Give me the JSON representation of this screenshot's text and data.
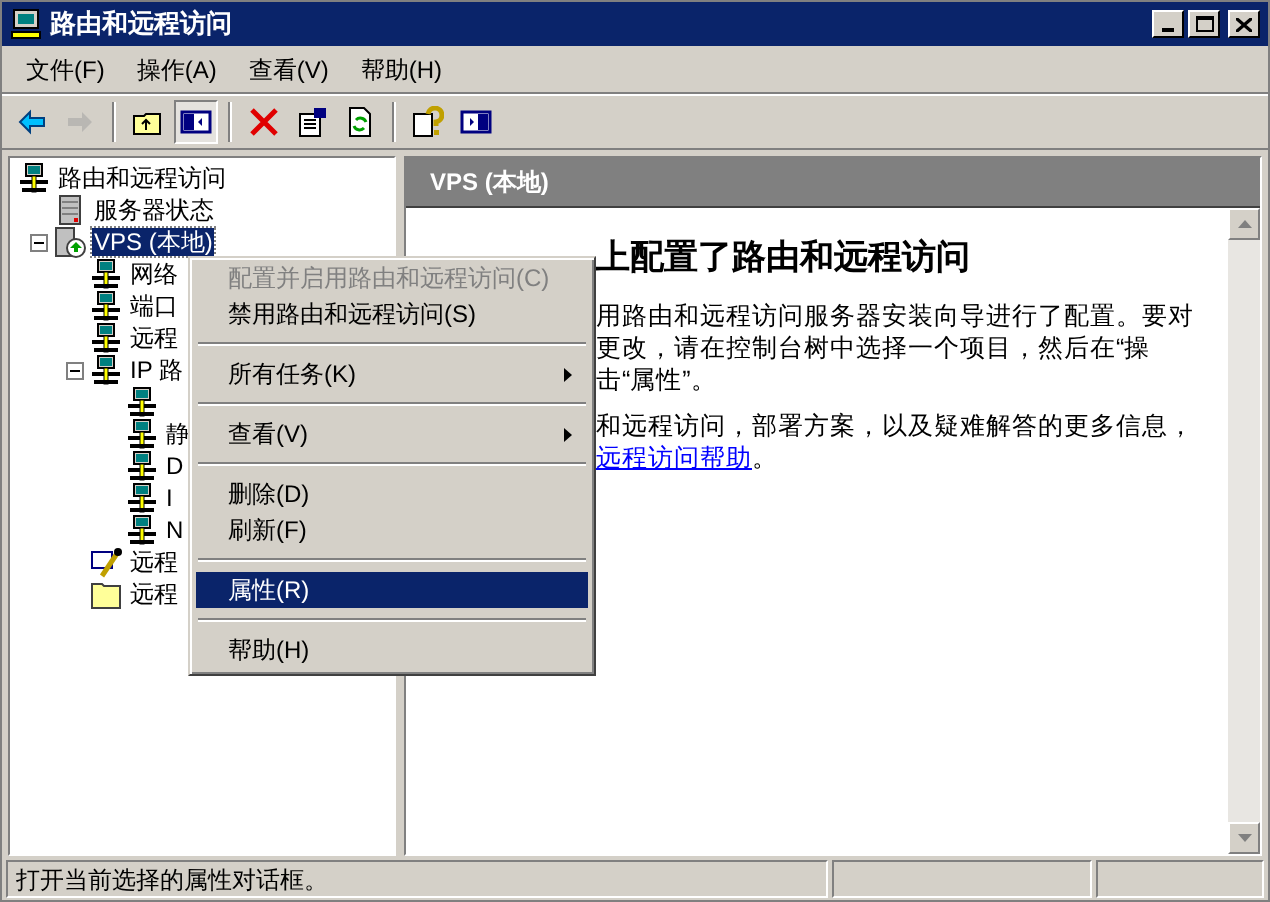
{
  "window": {
    "title": "路由和远程访问"
  },
  "menu_bar": [
    "文件(F)",
    "操作(A)",
    "查看(V)",
    "帮助(H)"
  ],
  "toolbar": [
    {
      "kind": "back",
      "disabled": false
    },
    {
      "kind": "forward",
      "disabled": true
    },
    {
      "kind": "separator"
    },
    {
      "kind": "up",
      "disabled": false
    },
    {
      "kind": "toggle-tree",
      "disabled": false,
      "pressed": true
    },
    {
      "kind": "separator"
    },
    {
      "kind": "delete",
      "disabled": false
    },
    {
      "kind": "properties",
      "disabled": false
    },
    {
      "kind": "refresh",
      "disabled": false
    },
    {
      "kind": "separator"
    },
    {
      "kind": "help",
      "disabled": false
    },
    {
      "kind": "panel",
      "disabled": false
    }
  ],
  "tree": [
    {
      "label": "路由和远程访问",
      "kind": "computer",
      "selected": false,
      "children": [
        {
          "label": "服务器状态",
          "kind": "server",
          "selected": false
        },
        {
          "label": "VPS (本地)",
          "kind": "server-local",
          "selected": true,
          "expanded": true,
          "children": [
            {
              "label": "网络",
              "kind": "computer",
              "selected": false
            },
            {
              "label": "端口",
              "kind": "computer",
              "selected": false
            },
            {
              "label": "远程",
              "kind": "computer",
              "selected": false
            },
            {
              "label": "IP 路",
              "kind": "computer",
              "selected": false,
              "expanded": true,
              "children": [
                {
                  "kind": "computer"
                },
                {
                  "label": "静",
                  "kind": "computer"
                },
                {
                  "label": "D",
                  "kind": "computer"
                },
                {
                  "label": "I",
                  "kind": "computer"
                },
                {
                  "label": "N",
                  "kind": "computer"
                }
              ]
            },
            {
              "label": "远程",
              "kind": "policy",
              "selected": false
            },
            {
              "label": "远程",
              "kind": "folder",
              "selected": false
            }
          ]
        }
      ]
    }
  ],
  "content": {
    "header": "VPS (本地)",
    "heading": "上配置了路由和远程访问",
    "paragraphs": [
      {
        "lines": [
          "用路由和远程访问服务器安装向导进行了配置。要对",
          "更改，请在控制台树中选择一个项目，然后在“操",
          "击“属性”。"
        ]
      },
      {
        "lines": [
          "和远程访问，部署方案，以及疑难解答的更多信息，"
        ],
        "link": "远程访问帮助",
        "after_link": "。"
      }
    ]
  },
  "context_menu": [
    {
      "kind": "item",
      "label": "配置并启用路由和远程访问(C)",
      "disabled": true,
      "submenu": false,
      "selected": false
    },
    {
      "kind": "item",
      "label": "禁用路由和远程访问(S)",
      "disabled": false,
      "submenu": false,
      "selected": false
    },
    {
      "kind": "separator"
    },
    {
      "kind": "item",
      "label": "所有任务(K)",
      "disabled": false,
      "submenu": true,
      "selected": false
    },
    {
      "kind": "separator"
    },
    {
      "kind": "item",
      "label": "查看(V)",
      "disabled": false,
      "submenu": true,
      "selected": false
    },
    {
      "kind": "separator"
    },
    {
      "kind": "item",
      "label": "删除(D)",
      "disabled": false,
      "submenu": false,
      "selected": false
    },
    {
      "kind": "item",
      "label": "刷新(F)",
      "disabled": false,
      "submenu": false,
      "selected": false
    },
    {
      "kind": "separator"
    },
    {
      "kind": "item",
      "label": "属性(R)",
      "disabled": false,
      "submenu": false,
      "selected": true
    },
    {
      "kind": "separator"
    },
    {
      "kind": "item",
      "label": "帮助(H)",
      "disabled": false,
      "submenu": false,
      "selected": false
    }
  ],
  "status_bar": {
    "text": "打开当前选择的属性对话框。"
  }
}
